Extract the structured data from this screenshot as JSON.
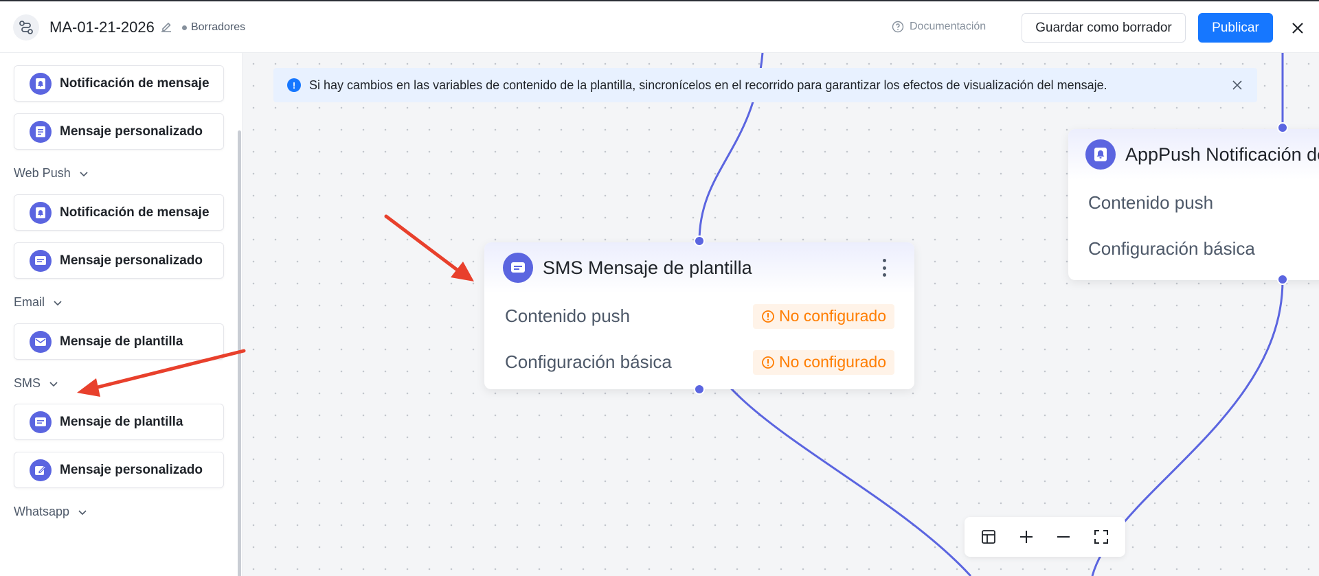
{
  "header": {
    "title": "MA-01-21-2026",
    "status": "Borradores",
    "doc_link": "Documentación",
    "save_draft": "Guardar como borrador",
    "publish": "Publicar"
  },
  "sidebar": {
    "top_items": [
      {
        "label": "Notificación de mensaje",
        "icon": "bell-icon"
      },
      {
        "label": "Mensaje personalizado",
        "icon": "document-icon"
      }
    ],
    "sections": [
      {
        "title": "Web Push",
        "items": [
          {
            "label": "Notificación de mensaje",
            "icon": "bell-icon"
          },
          {
            "label": "Mensaje personalizado",
            "icon": "message-icon"
          }
        ]
      },
      {
        "title": "Email",
        "items": [
          {
            "label": "Mensaje de plantilla",
            "icon": "envelope-icon"
          }
        ]
      },
      {
        "title": "SMS",
        "items": [
          {
            "label": "Mensaje de plantilla",
            "icon": "message-icon"
          },
          {
            "label": "Mensaje personalizado",
            "icon": "edit-icon"
          }
        ]
      },
      {
        "title": "Whatsapp",
        "items": []
      }
    ]
  },
  "banner": {
    "text": "Si hay cambios en las variables de contenido de la plantilla, sincronícelos en el recorrido para garantizar los efectos de visualización del mensaje."
  },
  "sms_node": {
    "title": "SMS Mensaje de plantilla",
    "rows": [
      {
        "label": "Contenido push",
        "status": "No configurado"
      },
      {
        "label": "Configuración básica",
        "status": "No configurado"
      }
    ]
  },
  "apppush_node": {
    "title": "AppPush Notificación de",
    "rows": [
      {
        "label": "Contenido push"
      },
      {
        "label": "Configuración básica"
      }
    ]
  },
  "colors": {
    "accent": "#5b65e0",
    "primary_button": "#1677ff",
    "warning": "#ff7d00",
    "annotation_arrow": "#e8402c"
  }
}
